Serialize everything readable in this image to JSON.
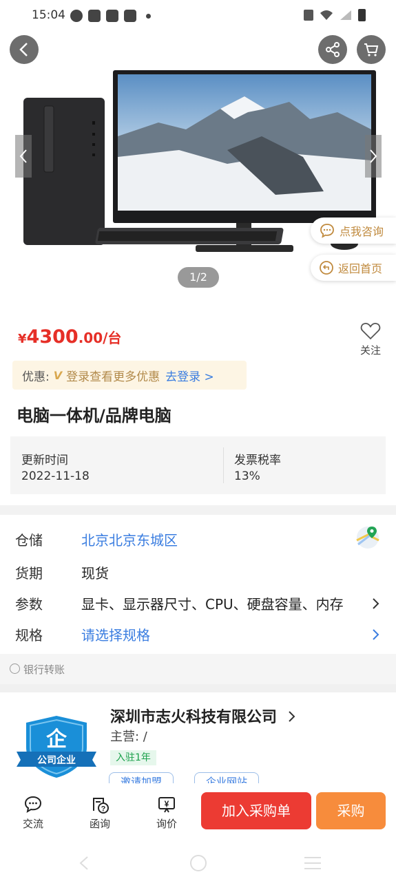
{
  "status_bar": {
    "time": "15:04"
  },
  "gallery": {
    "page_indicator": "1/2"
  },
  "floating": {
    "consult_label": "点我咨询",
    "home_label": "返回首页"
  },
  "price": {
    "currency": "¥",
    "integer": "4300",
    "decimal": ".00",
    "unit": "/台"
  },
  "follow": {
    "label": "关注"
  },
  "promo": {
    "label": "优惠:",
    "vip": "V",
    "text": "登录查看更多优惠",
    "login": "去登录 >"
  },
  "product": {
    "title": "电脑一体机/品牌电脑"
  },
  "info": {
    "update_key": "更新时间",
    "update_val": "2022-11-18",
    "tax_key": "发票税率",
    "tax_val": "13%"
  },
  "details": {
    "warehouse_key": "仓储",
    "warehouse_val": "北京北京东城区",
    "delivery_key": "货期",
    "delivery_val": "现货",
    "params_key": "参数",
    "params_val": "显卡、显示器尺寸、CPU、硬盘容量、内存",
    "spec_key": "规格",
    "spec_val": "请选择规格"
  },
  "payment": {
    "bank_transfer": "银行转账"
  },
  "store": {
    "badge_text": "公司企业",
    "name": "深圳市志火科技有限公司",
    "main_business": "主营: /",
    "tenure": "入驻1年",
    "btn_invite": "邀请加盟",
    "btn_site": "企业网站"
  },
  "bottom": {
    "chat": "交流",
    "inquiry_letter": "函询",
    "inquiry_price": "询价",
    "add_cart": "加入采购单",
    "buy": "采购"
  },
  "colors": {
    "price_red": "#e62f27",
    "link_blue": "#3a7de0",
    "buy_orange": "#f78c3c",
    "cart_red": "#ec3b33"
  }
}
